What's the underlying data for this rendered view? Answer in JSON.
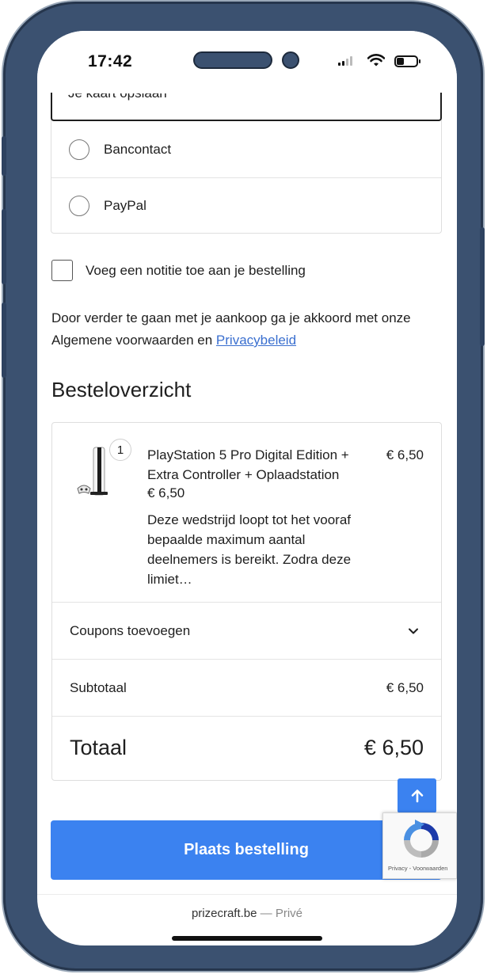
{
  "status_bar": {
    "time": "17:42"
  },
  "payment": {
    "card_save_label": "Je kaart opslaan",
    "options": [
      {
        "label": "Bancontact"
      },
      {
        "label": "PayPal"
      }
    ]
  },
  "note": {
    "label": "Voeg een notitie toe aan je bestelling"
  },
  "terms": {
    "text": "Door verder te gaan met je aankoop ga je akkoord met onze Algemene voorwaarden en",
    "link": "Privacybeleid"
  },
  "summary": {
    "heading": "Besteloverzicht",
    "item": {
      "quantity": "1",
      "name": "PlayStation 5 Pro Digital Edition + Extra Controller + Oplaadstation",
      "unit_price": "€ 6,50",
      "description": "Deze wedstrijd loopt tot het vooraf bepaalde maximum aantal deelnemers is bereikt. Zodra deze limiet…",
      "line_price": "€ 6,50"
    },
    "coupons_label": "Coupons toevoegen",
    "subtotal_label": "Subtotaal",
    "subtotal_value": "€ 6,50",
    "total_label": "Totaal",
    "total_value": "€ 6,50"
  },
  "place_order_label": "Plaats bestelling",
  "recaptcha": {
    "links": "Privacy - Voorwaarden"
  },
  "footer": {
    "site": "prizecraft.be",
    "separator": " — ",
    "suffix": "Privé"
  },
  "colors": {
    "accent": "#3b82f0",
    "link": "#3a6fcf",
    "frame": "#3b5170"
  },
  "icons": [
    "wifi-icon",
    "battery-icon",
    "signal-icon",
    "chevron-down-icon",
    "arrow-up-icon",
    "recaptcha-icon"
  ]
}
